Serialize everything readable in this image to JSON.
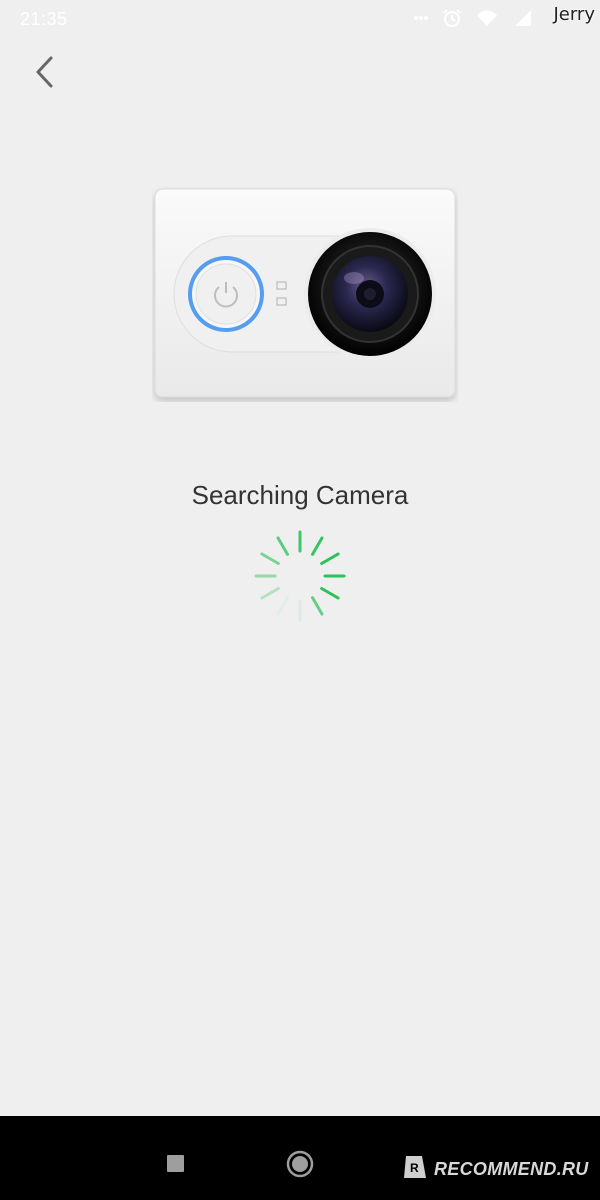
{
  "status_bar": {
    "time": "21:35",
    "icons": [
      "notification-dots-icon",
      "alarm-icon",
      "wifi-icon",
      "signal-icon",
      "battery-icon"
    ]
  },
  "watermark": {
    "name": "Jerry",
    "site": "RECOMMEND.RU"
  },
  "header": {
    "back_icon": "chevron-left-icon"
  },
  "main": {
    "illustration": "action-camera",
    "status_text": "Searching Camera",
    "spinner_color": "#2bc25a"
  },
  "nav_bar": {
    "buttons": [
      "recents-button",
      "home-button"
    ]
  },
  "colors": {
    "background": "#efefef",
    "accent_green": "#2bc25a",
    "power_ring_blue": "#3a8ef0"
  }
}
